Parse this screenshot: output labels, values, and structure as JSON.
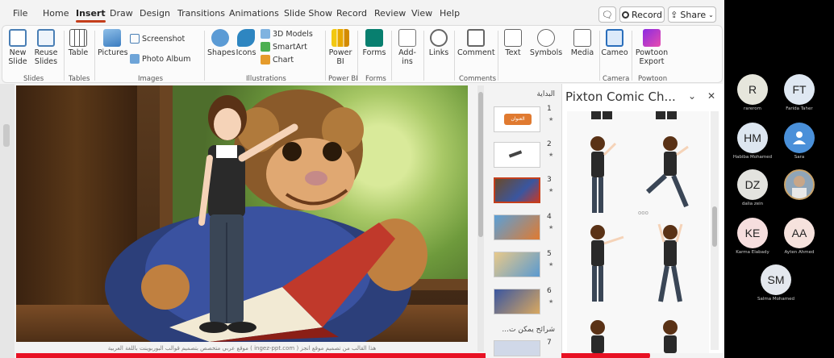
{
  "menu": {
    "tabs": [
      "File",
      "Home",
      "Insert",
      "Draw",
      "Design",
      "Transitions",
      "Animations",
      "Slide Show",
      "Record",
      "Review",
      "View",
      "Help"
    ],
    "active_tab": "Insert",
    "record_label": "Record",
    "share_label": "Share"
  },
  "ribbon": {
    "new_slide": "New Slide",
    "reuse_slides": "Reuse Slides",
    "table": "Table",
    "pictures": "Pictures",
    "screenshot": "Screenshot",
    "photo_album": "Photo Album",
    "shapes": "Shapes",
    "icons": "Icons",
    "models_3d": "3D Models",
    "smartart": "SmartArt",
    "chart": "Chart",
    "power_bi": "Power BI",
    "forms": "Forms",
    "addins": "Add-ins",
    "links": "Links",
    "comment": "Comment",
    "text": "Text",
    "symbols": "Symbols",
    "media": "Media",
    "cameo": "Cameo",
    "powtoon_export": "Powtoon Export",
    "groups": {
      "slides": "Slides",
      "tables": "Tables",
      "images": "Images",
      "illustrations": "Illustrations",
      "power_bi": "Power BI",
      "forms": "Forms",
      "comments": "Comments",
      "camera": "Camera",
      "powtoon": "Powtoon"
    }
  },
  "slide_caption": "هذا القالب من تصميم موقع انجز ( ingez-ppt.com ) موقع عربي متخصص بتصميم قوالب البوربوينت باللغة العربية",
  "thumbnails": {
    "section1": "البداية",
    "section2": "شرائح يمكن ت...",
    "numbers": [
      "1",
      "2",
      "3",
      "4",
      "5",
      "6",
      "7"
    ],
    "first_thumb_text": "العنوان"
  },
  "pane": {
    "title": "Pixton Comic Ch...",
    "collapse": "⌄",
    "close": "✕"
  },
  "participants": [
    {
      "initials": "R",
      "name": "rarerom",
      "color": "#e6e6dc"
    },
    {
      "initials": "FT",
      "name": "Farida Taher",
      "color": "#dfe8f2"
    },
    {
      "initials": "HM",
      "name": "Habiba Mohamed",
      "color": "#dde6f0"
    },
    {
      "initials": "",
      "name": "Sara",
      "color": "#4a90d9"
    },
    {
      "initials": "DZ",
      "name": "dalia zein",
      "color": "#e3e3df"
    },
    {
      "initials": "",
      "name": "",
      "color": "#a9b7c2"
    },
    {
      "initials": "KE",
      "name": "Karma Elabady",
      "color": "#f6dede"
    },
    {
      "initials": "AA",
      "name": "Ayten Ahmed",
      "color": "#f6e2dd"
    },
    {
      "initials": "SM",
      "name": "Salma Mohamed",
      "color": "#e4e8ee"
    }
  ],
  "colors": {
    "accent": "#c43e1c",
    "progress": "#e81123"
  }
}
